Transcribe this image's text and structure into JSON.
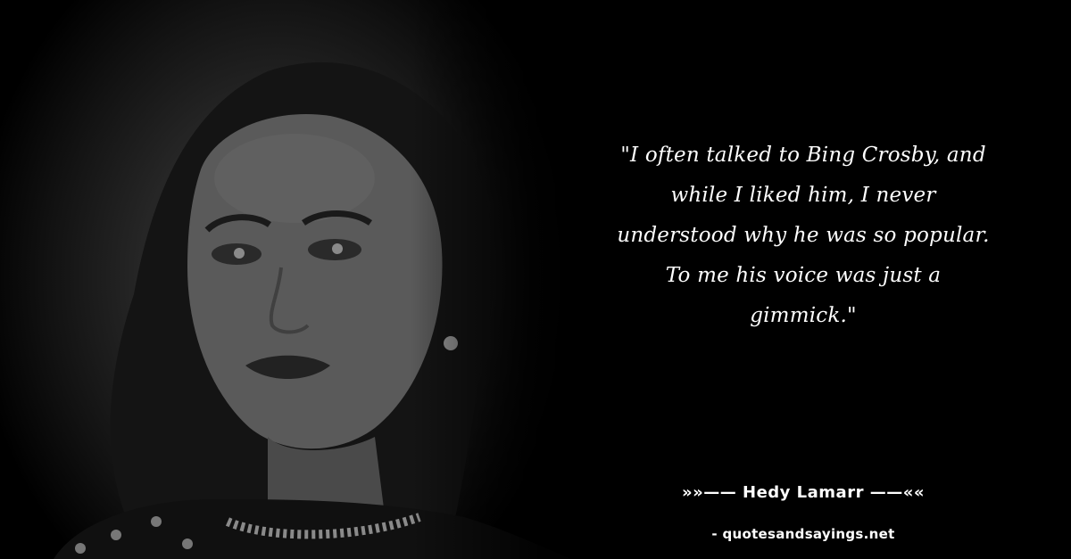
{
  "quote": {
    "text": "\"I often talked to Bing Crosby, and while I liked him, I never understood why he was so popular. To me his voice was just a gimmick.\""
  },
  "author": {
    "name": "»»—— Hedy Lamarr ——««"
  },
  "site": {
    "credit": "- quotesandsayings.net"
  },
  "colors": {
    "background": "#000000",
    "text": "#ffffff"
  }
}
